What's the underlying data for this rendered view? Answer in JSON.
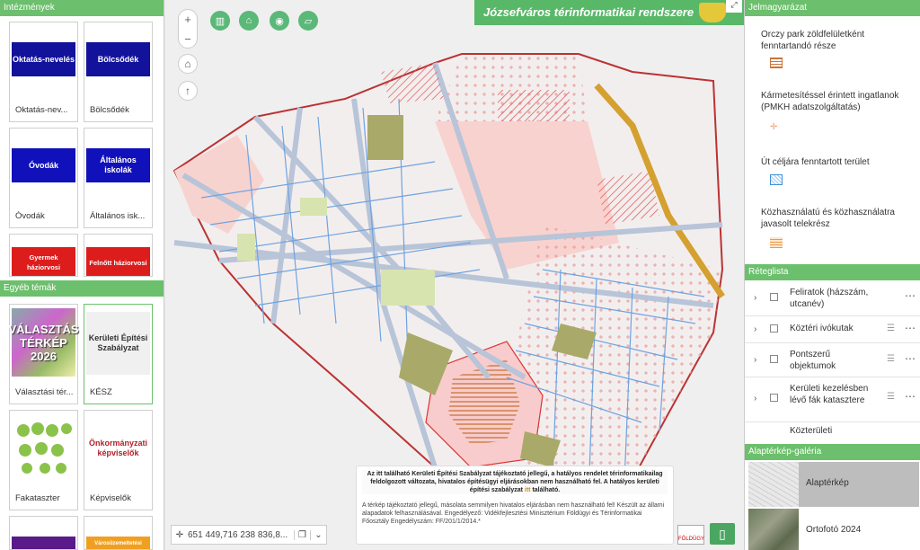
{
  "left_panels": {
    "institutions_title": "Intézmények",
    "institution_tiles": [
      {
        "thumb": "Oktatás-nevelés",
        "caption": "Oktatás-nev...",
        "color": "#12129a"
      },
      {
        "thumb": "Bölcsődék",
        "caption": "Bölcsődék",
        "color": "#12129a"
      },
      {
        "thumb": "Óvodák",
        "caption": "Óvodák",
        "color": "#1111bb"
      },
      {
        "thumb": "Általános iskolák",
        "caption": "Általános isk...",
        "color": "#1111bb"
      },
      {
        "thumb": "Gyermek háziorvosi",
        "caption": "",
        "color": "#dd1c1c"
      },
      {
        "thumb": "Felnőtt háziorvosi",
        "caption": "",
        "color": "#dd1c1c"
      }
    ],
    "other_title": "Egyéb témák",
    "other_tiles": [
      {
        "thumb": "VÁLASZTÁS TÉRKÉP 2026",
        "caption": "Választási tér..."
      },
      {
        "thumb": "Kerületi Építési Szabályzat",
        "caption": "KÉSZ"
      },
      {
        "thumb": "",
        "caption": "Fakataszter"
      },
      {
        "thumb": "Önkormányzati képviselők",
        "caption": "Képviselők"
      },
      {
        "thumb": "",
        "caption": ""
      },
      {
        "thumb": "Városüzemeltetési",
        "caption": ""
      }
    ]
  },
  "map": {
    "title": "Józsefváros térinformatikai rendszere",
    "coordinates": "651 449,716 238 836,8...",
    "notice_bold": "Az itt található Kerületi Építési Szabályzat tájékoztató jellegű, a hatályos rendelet térinformatikailag feldolgozott változata, hivatalos építésügyi eljárásokban nem használható fel. A hatályos kerületi építési szabályzat",
    "notice_link": "itt",
    "notice_bold_end": "található.",
    "notice_text": "A térkép tájékoztató jellegű, másolata semmilyen hivatalos eljárásban nem használható fel! Készült az állami alapadatok felhasználásával. Engedélyező: Vidékfejlesztési Minisztérium Földügyi és Térinformatikai Főosztály Engedélyszám: FF/201/1/2014.*",
    "logo_label": "FÖLDÜGY"
  },
  "legend": {
    "title": "Jelmagyarázat",
    "items": [
      {
        "label": "Orczy park zöldfelületként fenntartandó része",
        "color": "#c8743a"
      },
      {
        "label": "Kármetesítéssel érintett ingatlanok (PMKH adatszolgáltatás)",
        "color": "#e8a07a"
      },
      {
        "label": "Út céljára fenntartott terület",
        "color": "#3f8fd6"
      },
      {
        "label": "Közhasználatú és közhasználatra javasolt telekrész",
        "color": "#e89a4a"
      }
    ]
  },
  "layers": {
    "title": "Réteglista",
    "items": [
      {
        "label": "Feliratok (házszám, utcanév)"
      },
      {
        "label": "Köztéri ivókutak"
      },
      {
        "label": "Pontszerű objektumok"
      },
      {
        "label": "Kerületi kezelésben lévő fák katasztere"
      },
      {
        "label": "Közterületi"
      }
    ]
  },
  "gallery": {
    "title": "Alaptérkép-galéria",
    "items": [
      {
        "label": "Alaptérkép"
      },
      {
        "label": "Ortofotó 2024"
      }
    ]
  },
  "colors": {
    "accent": "#58b868",
    "panel_head": "#6cbf6c"
  }
}
